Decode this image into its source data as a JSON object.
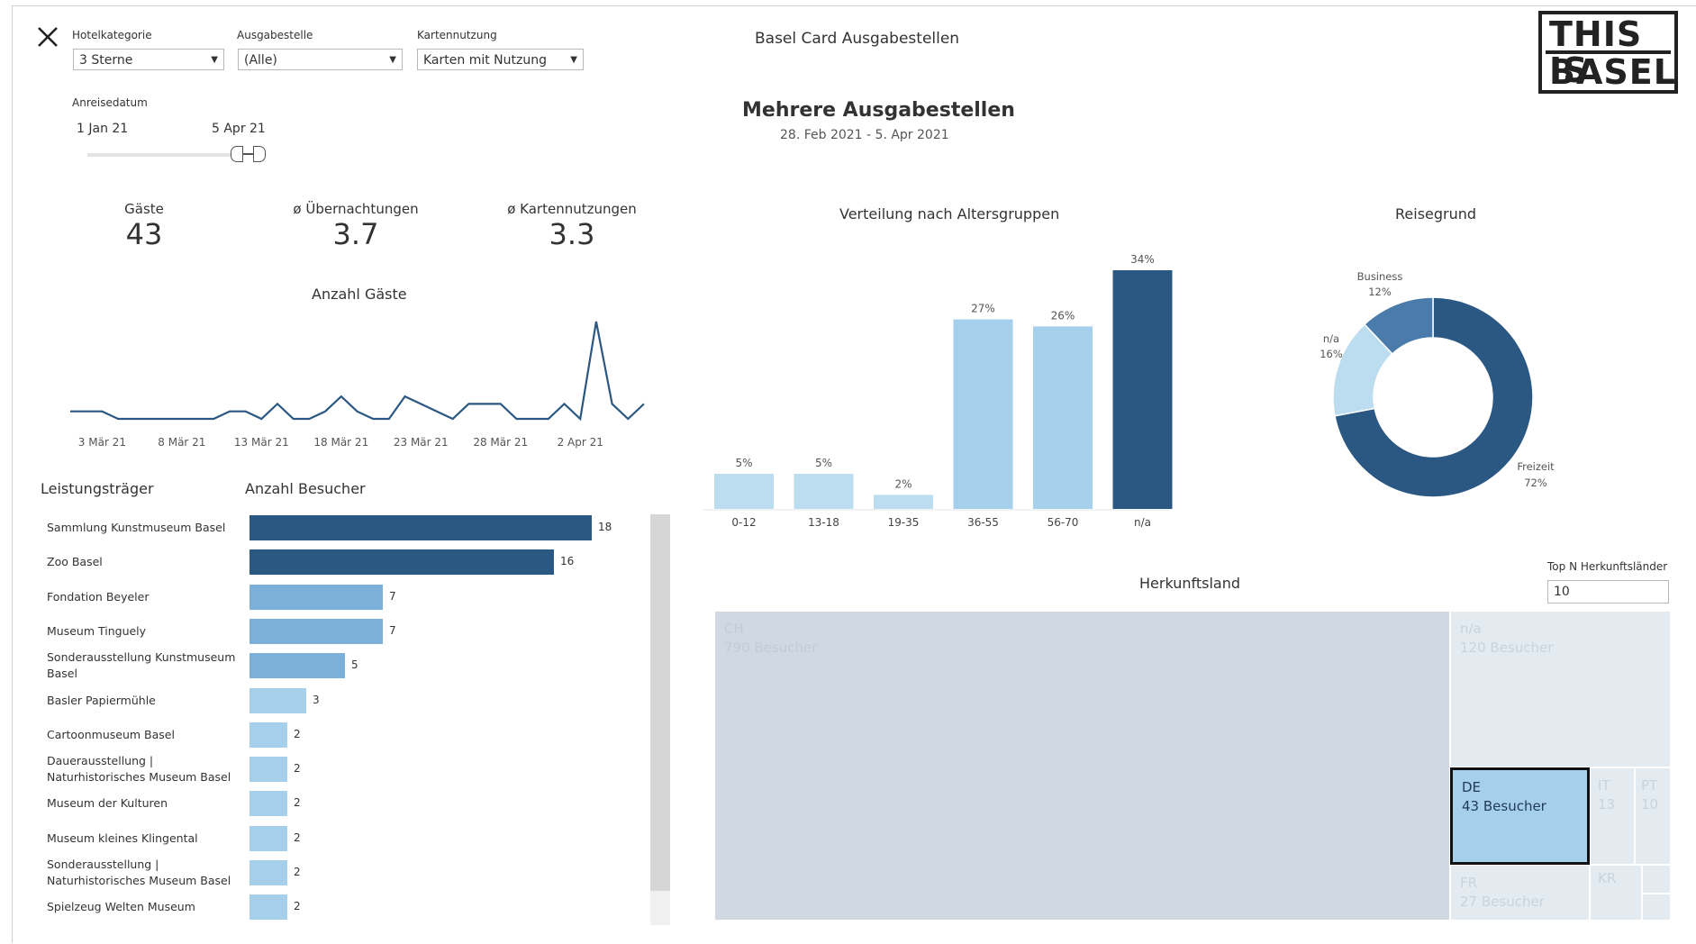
{
  "filters": {
    "hotelkategorie": {
      "label": "Hotelkategorie",
      "value": "3 Sterne"
    },
    "ausgabestelle": {
      "label": "Ausgabestelle",
      "value": "(Alle)"
    },
    "kartennutzung": {
      "label": "Kartennutzung",
      "value": "Karten mit Nutzung"
    },
    "anreisedatum": {
      "label": "Anreisedatum",
      "start": "1 Jan 21",
      "end": "5 Apr 21"
    }
  },
  "header": {
    "title": "Basel Card Ausgabestellen",
    "subtitle": "Mehrere Ausgabestellen",
    "daterange": "28. Feb 2021 - 5. Apr 2021"
  },
  "logo": {
    "line1": "THIS IS",
    "line2": "BASEL"
  },
  "kpis": [
    {
      "label": "Gäste",
      "value": "43"
    },
    {
      "label": "ø Übernachtungen",
      "value": "3.7"
    },
    {
      "label": "ø Kartennutzungen",
      "value": "3.3"
    }
  ],
  "colors": {
    "dark": "#2b5783",
    "mid": "#4a7bab",
    "medium": "#7bb0da",
    "light": "#a6cfeb",
    "pale": "#bcdcef",
    "treemap_main": "#d0d9e2",
    "treemap_light": "#e3ebf1"
  },
  "line_chart": {
    "title": "Anzahl Gäste",
    "type": "line",
    "x_ticks": [
      "3 Mär 21",
      "8 Mär 21",
      "13 Mär 21",
      "18 Mär 21",
      "23 Mär 21",
      "28 Mär 21",
      "2 Apr 21"
    ],
    "values": [
      1,
      1,
      1,
      0,
      0,
      0,
      0,
      0,
      0,
      0,
      1,
      1,
      0,
      2,
      0,
      0,
      1,
      3,
      1,
      0,
      0,
      3,
      2,
      1,
      0,
      2,
      2,
      2,
      0,
      0,
      0,
      2,
      0,
      13,
      2,
      0,
      2
    ]
  },
  "leistungstraeger": {
    "title": "Leistungsträger",
    "value_title": "Anzahl Besucher",
    "type": "bar",
    "items": [
      {
        "name": "Sammlung Kunstmuseum Basel",
        "value": 18,
        "tone": "dark"
      },
      {
        "name": "Zoo Basel",
        "value": 16,
        "tone": "dark"
      },
      {
        "name": "Fondation Beyeler",
        "value": 7,
        "tone": "medium"
      },
      {
        "name": "Museum Tinguely",
        "value": 7,
        "tone": "medium"
      },
      {
        "name": "Sonderausstellung Kunstmuseum Basel",
        "value": 5,
        "tone": "medium"
      },
      {
        "name": "Basler Papiermühle",
        "value": 3,
        "tone": "light"
      },
      {
        "name": "Cartoonmuseum Basel",
        "value": 2,
        "tone": "light"
      },
      {
        "name": "Dauerausstellung | Naturhistorisches Museum Basel",
        "value": 2,
        "tone": "light"
      },
      {
        "name": "Museum der Kulturen",
        "value": 2,
        "tone": "light"
      },
      {
        "name": "Museum kleines Klingental",
        "value": 2,
        "tone": "light"
      },
      {
        "name": "Sonderausstellung | Naturhistorisches Museum Basel",
        "value": 2,
        "tone": "light"
      },
      {
        "name": "Spielzeug Welten Museum",
        "value": 2,
        "tone": "light"
      }
    ]
  },
  "age_chart": {
    "title": "Verteilung nach Altersgruppen",
    "type": "bar",
    "categories": [
      "0-12",
      "13-18",
      "19-35",
      "36-55",
      "56-70",
      "n/a"
    ],
    "values": [
      5,
      5,
      2,
      27,
      26,
      34
    ],
    "labels": [
      "5%",
      "5%",
      "2%",
      "27%",
      "26%",
      "34%"
    ],
    "ylim": [
      0,
      34
    ]
  },
  "reisegrund": {
    "title": "Reisegrund",
    "type": "pie",
    "slices": [
      {
        "name": "Freizeit",
        "value": 72,
        "label": "72%",
        "tone": "dark"
      },
      {
        "name": "n/a",
        "value": 16,
        "label": "16%",
        "tone": "light"
      },
      {
        "name": "Business",
        "value": 12,
        "label": "12%",
        "tone": "mid"
      }
    ]
  },
  "herkunft": {
    "title": "Herkunftsland",
    "topn_label": "Top N Herkunftsländer",
    "topn_value": "10",
    "cells": [
      {
        "code": "CH",
        "visitors": "790 Besucher"
      },
      {
        "code": "n/a",
        "visitors": "120 Besucher"
      },
      {
        "code": "DE",
        "visitors": "43 Besucher"
      },
      {
        "code": "IT",
        "visitors": "13"
      },
      {
        "code": "PT",
        "visitors": "10"
      },
      {
        "code": "FR",
        "visitors": "27 Besucher"
      },
      {
        "code": "KR",
        "visitors": ""
      }
    ]
  }
}
